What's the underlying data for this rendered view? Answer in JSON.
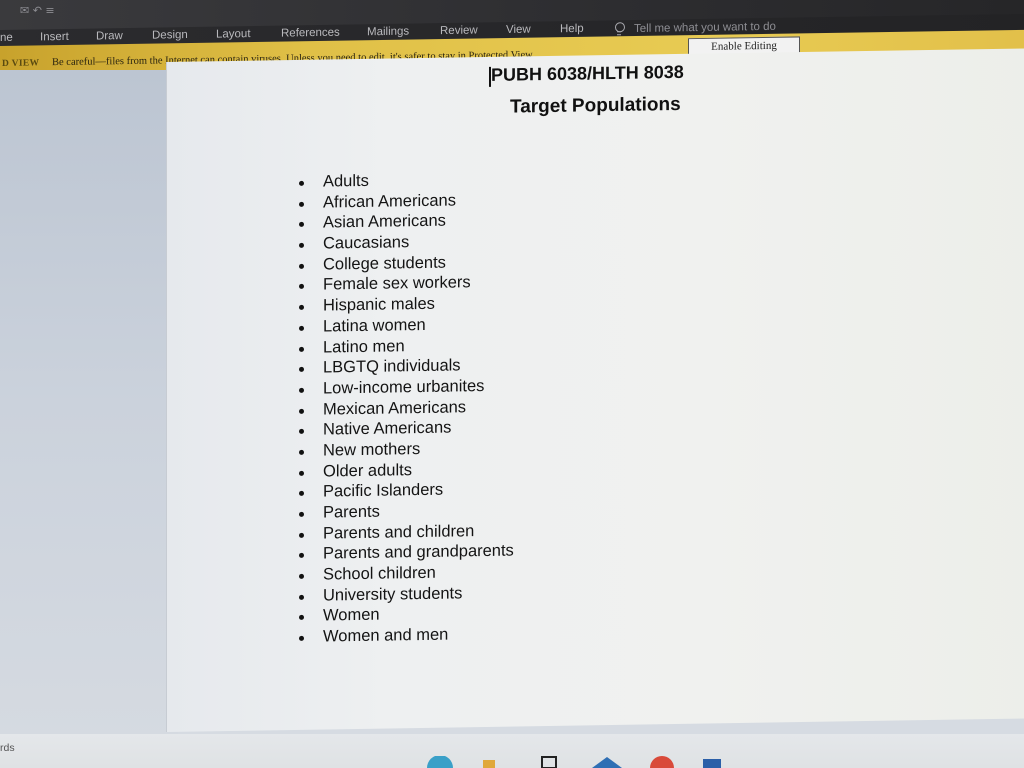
{
  "ribbon": {
    "tabs": [
      {
        "label": "ne"
      },
      {
        "label": "Insert"
      },
      {
        "label": "Draw"
      },
      {
        "label": "Design"
      },
      {
        "label": "Layout"
      },
      {
        "label": "References"
      },
      {
        "label": "Mailings"
      },
      {
        "label": "Review"
      },
      {
        "label": "View"
      },
      {
        "label": "Help"
      }
    ],
    "tell_me": "Tell me what you want to do"
  },
  "protected_view": {
    "label": "D VIEW",
    "message": "Be careful—files from the Internet can contain viruses. Unless you need to edit, it's safer to stay in Protected View.",
    "button_label": "Enable Editing"
  },
  "document": {
    "title": "PUBH 6038/HLTH 8038",
    "subtitle": "Target Populations",
    "items": [
      "Adults",
      "African Americans",
      "Asian Americans",
      "Caucasians",
      "College students",
      "Female sex workers",
      "Hispanic males",
      "Latina women",
      "Latino men",
      "LBGTQ individuals",
      "Low-income urbanites",
      "Mexican Americans",
      "Native Americans",
      "New mothers",
      "Older adults",
      "Pacific Islanders",
      "Parents",
      "Parents and children",
      "Parents and grandparents",
      "School children",
      "University students",
      "Women",
      "Women and men"
    ]
  },
  "status": {
    "words_label": "rds"
  },
  "colors": {
    "ribbon_bg": "#2d2d30",
    "protected_bar": "#e0c047",
    "page_bg": "#f0f1ef"
  }
}
